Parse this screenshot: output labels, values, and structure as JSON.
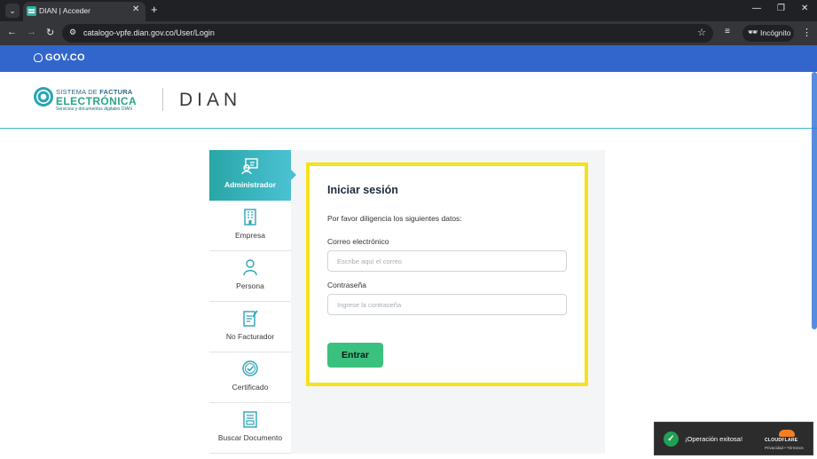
{
  "browser": {
    "tab_title": "DIAN | Acceder",
    "url": "catalogo-vpfe.dian.gov.co/User/Login",
    "incognito_label": "Incógnito"
  },
  "gov_bar": {
    "logo_text": "GOV.CO"
  },
  "header": {
    "line1_a": "SISTEMA DE ",
    "line1_b": "FACTURA",
    "line2": "ELECTRÓNICA",
    "line3": "Servicios y documentos digitales DIAN",
    "dian_logo": "DIAN"
  },
  "sidebar": {
    "items": [
      {
        "label": "Administrador",
        "icon": "admin-icon",
        "active": true
      },
      {
        "label": "Empresa",
        "icon": "building-icon"
      },
      {
        "label": "Persona",
        "icon": "person-icon"
      },
      {
        "label": "No Facturador",
        "icon": "document-edit-icon"
      },
      {
        "label": "Certificado",
        "icon": "certificate-icon"
      },
      {
        "label": "Buscar Documento",
        "icon": "search-document-icon"
      }
    ]
  },
  "form": {
    "title": "Iniciar sesión",
    "subtitle": "Por favor diligencia los siguientes datos:",
    "email_label": "Correo electrónico",
    "email_placeholder": "Escribe aquí el correo",
    "password_label": "Contraseña",
    "password_placeholder": "Ingrese la contraseña",
    "submit_label": "Entrar"
  },
  "toast": {
    "message": "¡Operación exitosa!",
    "brand": "CLOUDFLARE",
    "links": "Privacidad • Términos"
  },
  "colors": {
    "gov_blue": "#3366cc",
    "teal_accent": "#28a6a6",
    "highlight_yellow": "#f6e21b",
    "submit_green": "#3ac17e"
  }
}
